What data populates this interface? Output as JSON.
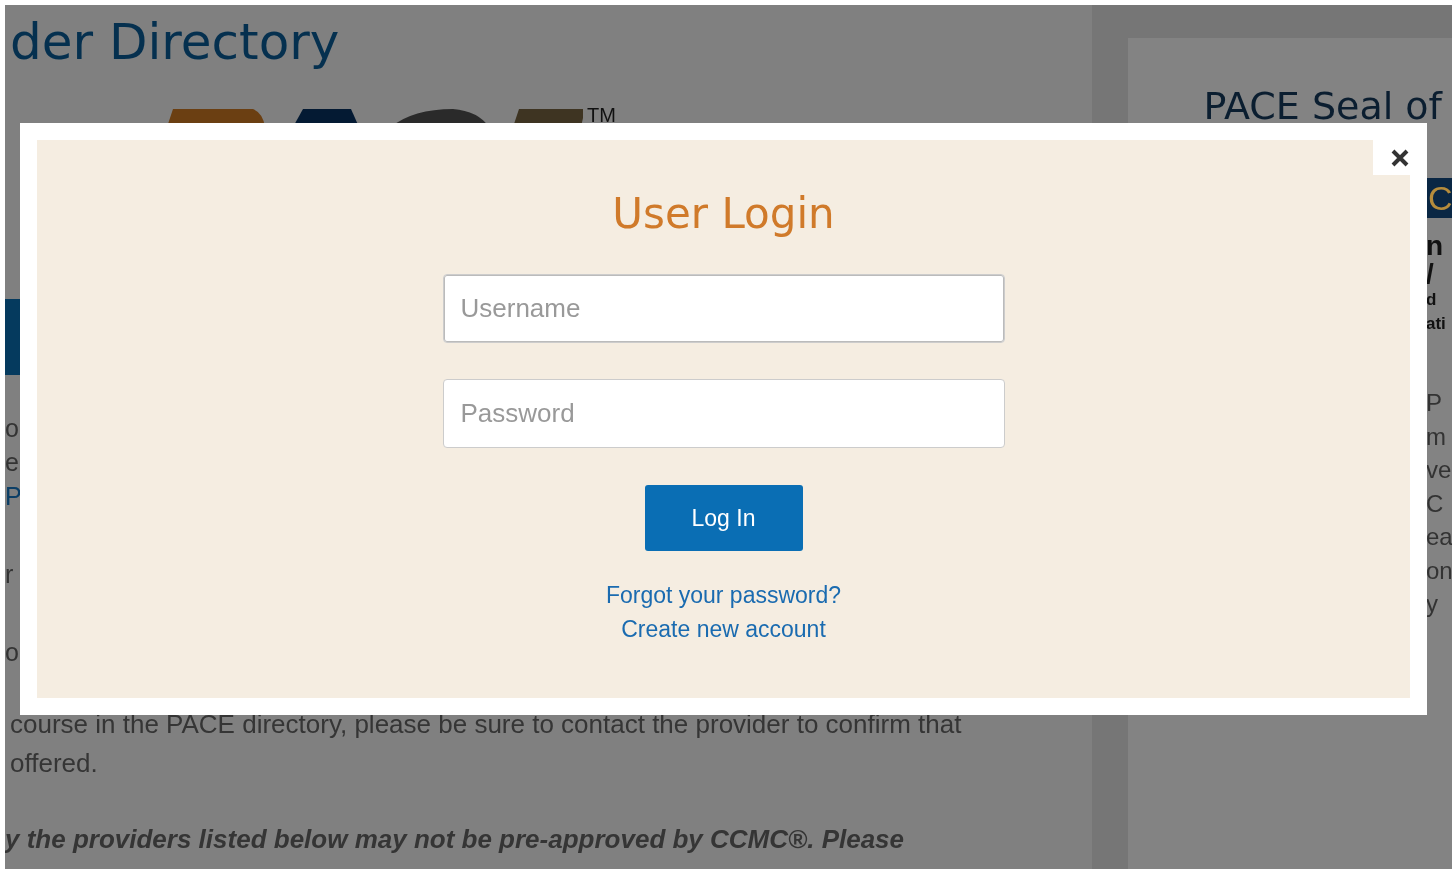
{
  "background": {
    "heading": "der Directory",
    "logo_mark": "TM",
    "left_fragments": [
      [
        {
          "text": "o",
          "kind": "plain"
        },
        {
          "text": "e",
          "kind": "plain"
        },
        {
          "text": "P",
          "kind": "link"
        }
      ],
      [
        {
          "text": "r",
          "kind": "plain"
        }
      ],
      [
        {
          "text": "o",
          "kind": "plain"
        }
      ]
    ],
    "paragraph_lines": [
      "course in the PACE directory, please be sure to contact the provider to confirm that",
      "offered."
    ],
    "notice": "y the providers listed below may not be pre-approved by CCMC®. Please"
  },
  "sidebar": {
    "title": "PACE Seal of",
    "banner_fragment": "C",
    "fragments": [
      [
        {
          "text": "n",
          "kind": "bold_large"
        },
        {
          "text": "/",
          "kind": "bold_large"
        },
        {
          "text": "d",
          "kind": "bold_small"
        },
        {
          "text": "ati",
          "kind": "bold_small"
        }
      ],
      [
        {
          "text": "P",
          "kind": "plain"
        },
        {
          "text": "m",
          "kind": "plain"
        },
        {
          "text": "ve",
          "kind": "plain"
        },
        {
          "text": "C",
          "kind": "plain"
        },
        {
          "text": "ea",
          "kind": "plain"
        },
        {
          "text": "on",
          "kind": "plain"
        },
        {
          "text": "y",
          "kind": "plain"
        }
      ]
    ]
  },
  "modal": {
    "title": "User Login",
    "username": {
      "placeholder": "Username",
      "focused": true
    },
    "password": {
      "placeholder": "Password"
    },
    "submit": "Log In",
    "links": [
      "Forgot your password?",
      "Create new account"
    ]
  }
}
